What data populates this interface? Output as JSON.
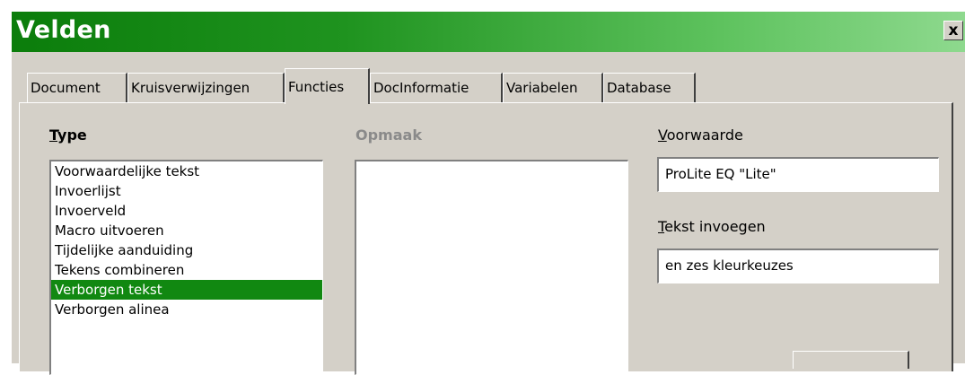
{
  "dialog": {
    "title": "Velden",
    "close_glyph": "x"
  },
  "tabs": [
    {
      "label": "Document",
      "active": false
    },
    {
      "label": "Kruisverwijzingen",
      "active": false
    },
    {
      "label": "Functies",
      "active": true
    },
    {
      "label": "DocInformatie",
      "active": false
    },
    {
      "label": "Variabelen",
      "active": false
    },
    {
      "label": "Database",
      "active": false
    }
  ],
  "type_section": {
    "label_mnemonic": "T",
    "label_rest": "ype",
    "items": [
      "Voorwaardelijke tekst",
      "Invoerlijst",
      "Invoerveld",
      "Macro uitvoeren",
      "Tijdelijke aanduiding",
      "Tekens combineren",
      "Verborgen tekst",
      "Verborgen alinea"
    ],
    "selected_index": 6
  },
  "format_section": {
    "label": "Opmaak",
    "items": []
  },
  "condition": {
    "label_mnemonic": "V",
    "label_rest": "oorwaarde",
    "value": "ProLite EQ \"Lite\""
  },
  "insert_text": {
    "label_mnemonic": "T",
    "label_rest": "ekst invoegen",
    "value": "en zes kleurkeuzes"
  },
  "colors": {
    "title_gradient_start": "#0b7d0b",
    "title_gradient_end": "#8ed98e",
    "selection": "#118811",
    "face": "#d4d0c8"
  }
}
